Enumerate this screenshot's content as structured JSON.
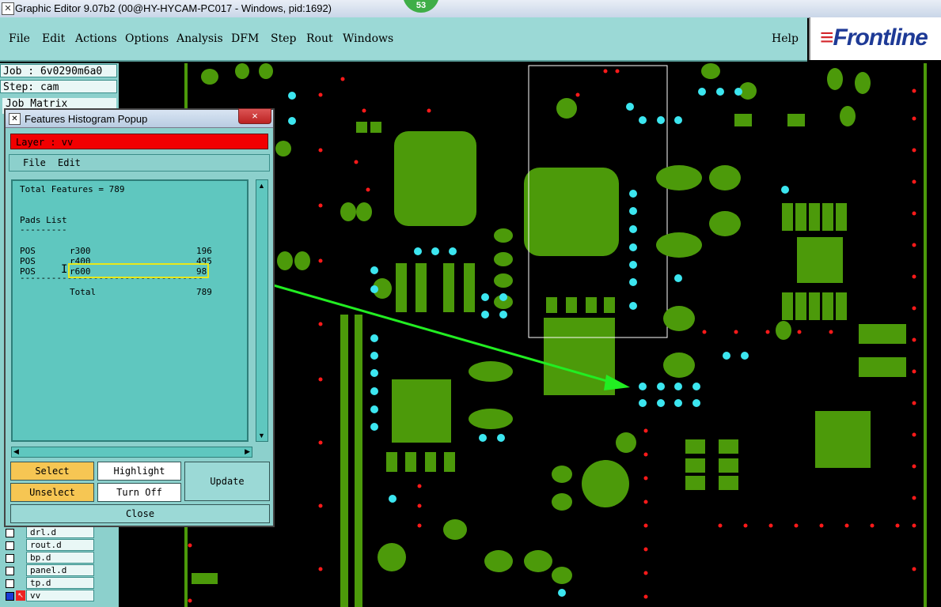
{
  "window": {
    "title": "Graphic Editor 9.07b2 (00@HY-HYCAM-PC017 - Windows, pid:1692)",
    "badge": "53"
  },
  "menu": {
    "items": [
      "File",
      "Edit",
      "Actions",
      "Options",
      "Analysis",
      "DFM",
      "Step",
      "Rout",
      "Windows"
    ],
    "help": "Help"
  },
  "logo": {
    "text": "Frontline"
  },
  "left": {
    "job": "Job : 6v0290m6a0",
    "step": "Step: cam",
    "job_matrix": "Job Matrix"
  },
  "layers": [
    {
      "name": "drl.d"
    },
    {
      "name": "rout.d"
    },
    {
      "name": "bp.d"
    },
    {
      "name": "panel.d"
    },
    {
      "name": "tp.d"
    },
    {
      "name": "vv"
    }
  ],
  "popup": {
    "title": "Features Histogram Popup",
    "close_x": "×",
    "layer_label": "Layer :  vv",
    "menu": [
      "File",
      "Edit"
    ],
    "total_line": "Total Features = 789",
    "section": "Pads List",
    "underline": "---------",
    "rows": [
      {
        "pol": "POS",
        "sym": "r300",
        "count": "196"
      },
      {
        "pol": "POS",
        "sym": "r400",
        "count": "495"
      },
      {
        "pol": "POS",
        "sym": "r600",
        "count": "98"
      }
    ],
    "separator": "-----------------------------------",
    "total_label": "Total",
    "total_value": "789",
    "buttons": {
      "select": "Select",
      "highlight": "Highlight",
      "update": "Update",
      "unselect": "Unselect",
      "turn_off": "Turn Off",
      "close": "Close"
    }
  },
  "colors": {
    "menu_bg": "#9bd9d6",
    "copper": "#4c9a0a",
    "red": "#ff1a1a",
    "cyan": "#3ce6f0",
    "arrow": "#22ee22",
    "highlight": "#e8e81a"
  }
}
